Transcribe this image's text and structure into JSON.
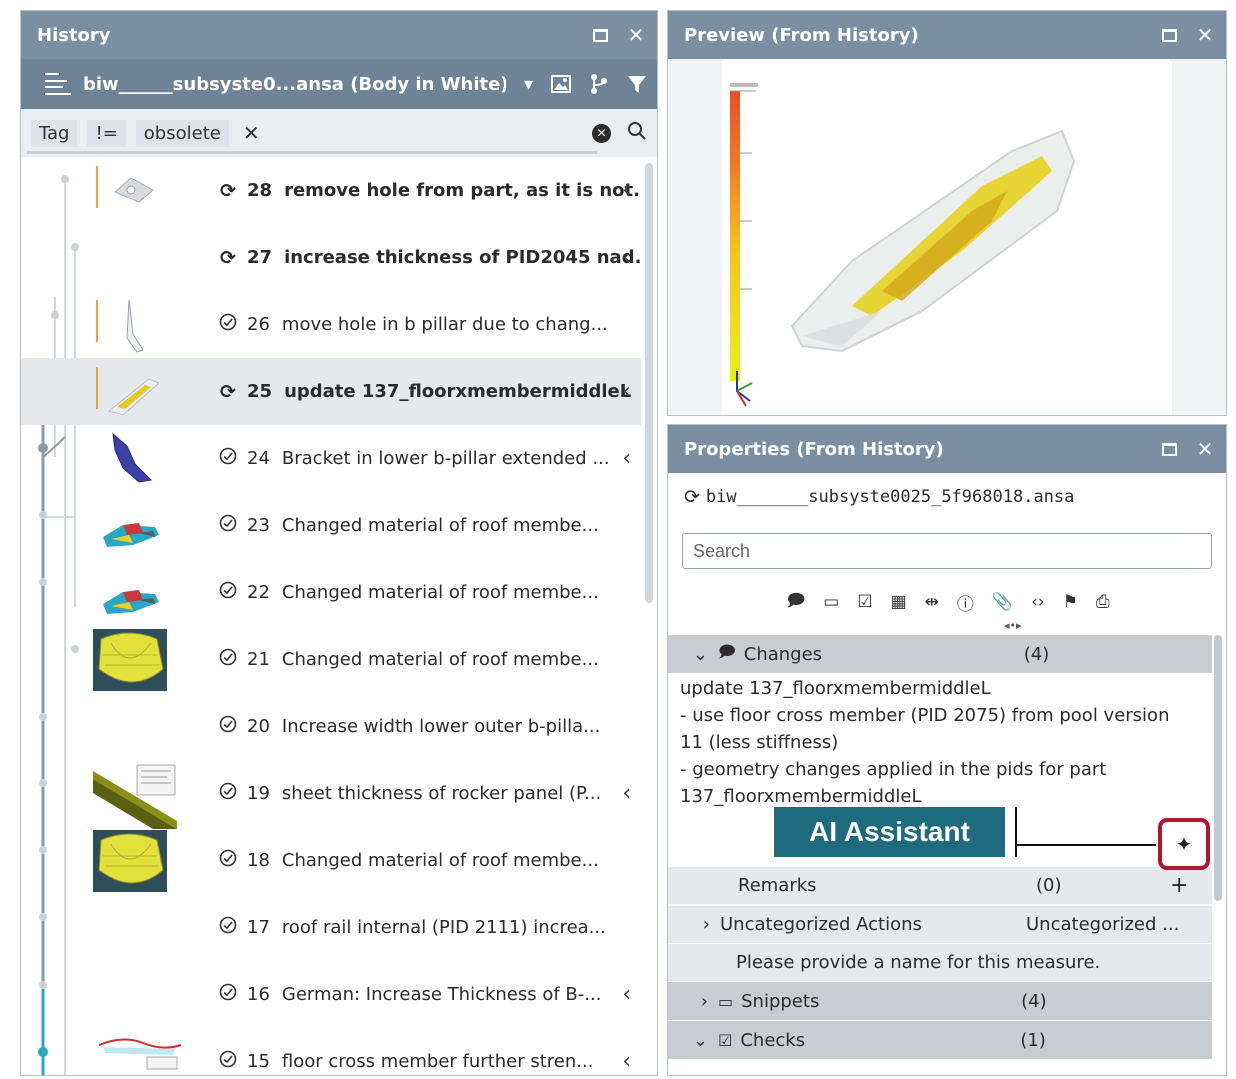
{
  "history": {
    "title": "History",
    "file": "biw______subsyste0...ansa (Body in White)",
    "filter": {
      "chips": [
        "Tag",
        "!=",
        "obsolete"
      ],
      "remove": "✕"
    },
    "rows": [
      {
        "num": "28",
        "text": "remove hole from part, as it is not.",
        "bold": true,
        "status": "sync",
        "chevron": true,
        "thumb": "part-gray"
      },
      {
        "num": "27",
        "text": "increase thickness of PID2045 nad.",
        "bold": true,
        "status": "sync",
        "chevron": true,
        "thumb": ""
      },
      {
        "num": "26",
        "text": "move hole in b pillar due to chang...",
        "bold": false,
        "status": "check",
        "chevron": false,
        "thumb": "pillar-white"
      },
      {
        "num": "25",
        "text": "update 137_floorxmembermiddleL",
        "bold": true,
        "status": "sync",
        "chevron": true,
        "thumb": "member-yellow",
        "selected": true
      },
      {
        "num": "24",
        "text": "Bracket in lower b-pillar extended ...",
        "bold": false,
        "status": "check",
        "chevron": true,
        "thumb": "bracket-blue"
      },
      {
        "num": "23",
        "text": "Changed material of roof membe...",
        "bold": false,
        "status": "check",
        "chevron": false,
        "thumb": "roof-color"
      },
      {
        "num": "22",
        "text": "Changed material of roof membe...",
        "bold": false,
        "status": "check",
        "chevron": false,
        "thumb": "roof-color"
      },
      {
        "num": "21",
        "text": "Changed material of roof membe...",
        "bold": false,
        "status": "check",
        "chevron": false,
        "thumb": "yellow-mesh"
      },
      {
        "num": "20",
        "text": "Increase width lower outer b-pilla...",
        "bold": false,
        "status": "check",
        "chevron": false,
        "thumb": ""
      },
      {
        "num": "19",
        "text": "sheet thickness of rocker panel (P...",
        "bold": false,
        "status": "check",
        "chevron": true,
        "thumb": "rocker"
      },
      {
        "num": "18",
        "text": "Changed material of roof membe...",
        "bold": false,
        "status": "check",
        "chevron": false,
        "thumb": "yellow-mesh"
      },
      {
        "num": "17",
        "text": "roof rail internal (PID 2111) increa...",
        "bold": false,
        "status": "check",
        "chevron": false,
        "thumb": ""
      },
      {
        "num": "16",
        "text": "German: Increase Thickness of B-...",
        "bold": false,
        "status": "check",
        "chevron": true,
        "thumb": ""
      },
      {
        "num": "15",
        "text": "floor cross member further stren...",
        "bold": false,
        "status": "check",
        "chevron": true,
        "thumb": "cross-member"
      }
    ]
  },
  "preview": {
    "title": "Preview (From History)"
  },
  "properties": {
    "title": "Properties (From History)",
    "file": "biw_______subsyste0025_5f968018.ansa",
    "search_placeholder": "Search",
    "changes": {
      "label": "Changes",
      "count": "(4)",
      "lines": [
        "update 137_floorxmembermiddleL",
        "- use floor cross member (PID 2075) from pool version",
        "11 (less stiffness)",
        "- geometry changes applied in the pids for part",
        "137_floorxmembermiddleL"
      ]
    },
    "remarks": {
      "label": "Remarks",
      "count": "(0)"
    },
    "uncategorized": {
      "label": "Uncategorized Actions",
      "value": "Uncategorized ..."
    },
    "measure_prompt": "Please provide a name for this measure.",
    "snippets": {
      "label": "Snippets",
      "count": "(4)"
    },
    "checks": {
      "label": "Checks",
      "count": "(1)"
    }
  },
  "callout": {
    "label": "AI Assistant"
  },
  "colors": {
    "title_bar": "#7b8fa3",
    "toolbar": "#6f8397",
    "callout": "#1f6b7e",
    "highlight": "#b0182e"
  }
}
